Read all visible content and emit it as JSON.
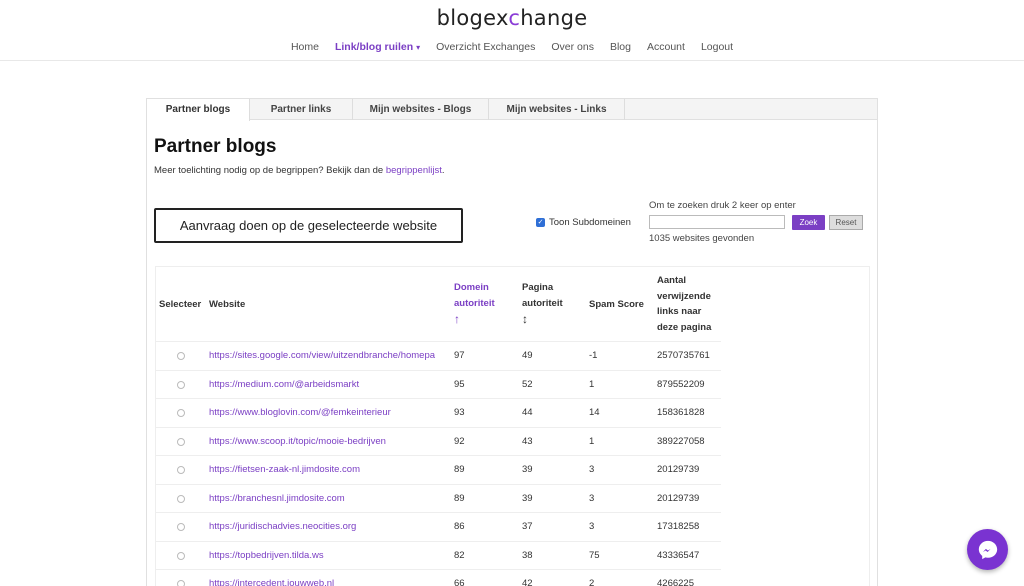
{
  "header": {
    "logo_pre": "blogex",
    "logo_x": "c",
    "logo_post": "hange",
    "nav": [
      {
        "label": "Home"
      },
      {
        "label": "Link/blog ruilen",
        "active": true
      },
      {
        "label": "Overzicht Exchanges"
      },
      {
        "label": "Over ons"
      },
      {
        "label": "Blog"
      },
      {
        "label": "Account"
      },
      {
        "label": "Logout"
      }
    ],
    "accent": "#7b3fc4"
  },
  "tabs": [
    {
      "label": "Partner blogs"
    },
    {
      "label": "Partner links"
    },
    {
      "label": "Mijn websites - Blogs"
    },
    {
      "label": "Mijn websites - Links"
    }
  ],
  "main": {
    "title": "Partner blogs",
    "subtitle_pre": "Meer toelichting nodig op de begrippen? Bekijk dan de ",
    "subtitle_link": "begrippenlijst",
    "subtitle_post": ".",
    "request_button": "Aanvraag doen op de geselecteerde website",
    "subdomain_label": "Toon Subdomeinen",
    "search_hint": "Om te zoeken druk 2 keer op enter",
    "search_value": "",
    "search_button": "Zoek",
    "reset_button": "Reset",
    "found_text": "1035 websites gevonden"
  },
  "table": {
    "headers": {
      "select": "Selecteer",
      "website": "Website",
      "domain_1": "Domein",
      "domain_2": "autoriteit",
      "page_1": "Pagina",
      "page_2": "autoriteit",
      "spam": "Spam Score",
      "links_1": "Aantal",
      "links_2": "verwijzende",
      "links_3": "links naar",
      "links_4": "deze pagina"
    },
    "rows": [
      {
        "url": "https://sites.google.com/view/uitzendbranche/homepa",
        "da": "97",
        "pa": "49",
        "spam": "-1",
        "links": "2570735761"
      },
      {
        "url": "https://medium.com/@arbeidsmarkt",
        "da": "95",
        "pa": "52",
        "spam": "1",
        "links": "879552209"
      },
      {
        "url": "https://www.bloglovin.com/@femkeinterieur",
        "da": "93",
        "pa": "44",
        "spam": "14",
        "links": "158361828"
      },
      {
        "url": "https://www.scoop.it/topic/mooie-bedrijven",
        "da": "92",
        "pa": "43",
        "spam": "1",
        "links": "389227058"
      },
      {
        "url": "https://fietsen-zaak-nl.jimdosite.com",
        "da": "89",
        "pa": "39",
        "spam": "3",
        "links": "20129739"
      },
      {
        "url": "https://branchesnl.jimdosite.com",
        "da": "89",
        "pa": "39",
        "spam": "3",
        "links": "20129739"
      },
      {
        "url": "https://juridischadvies.neocities.org",
        "da": "86",
        "pa": "37",
        "spam": "3",
        "links": "17318258"
      },
      {
        "url": "https://topbedrijven.tilda.ws",
        "da": "82",
        "pa": "38",
        "spam": "75",
        "links": "43336547"
      },
      {
        "url": "https://intercedent.jouwweb.nl",
        "da": "66",
        "pa": "42",
        "spam": "2",
        "links": "4266225"
      }
    ]
  }
}
